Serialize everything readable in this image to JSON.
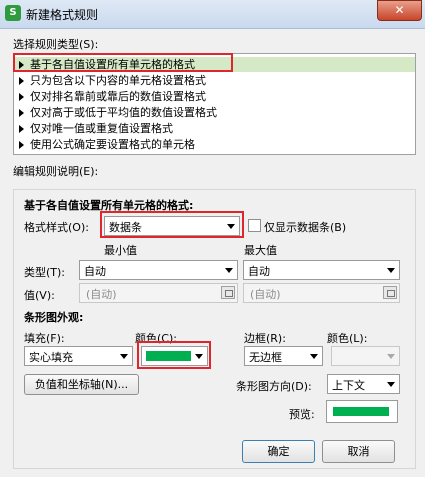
{
  "window": {
    "title": "新建格式规则",
    "app_icon_glyph": "S",
    "close_glyph": "✕"
  },
  "rule_type": {
    "label": "选择规则类型(S):",
    "items": [
      "基于各自值设置所有单元格的格式",
      "只为包含以下内容的单元格设置格式",
      "仅对排名靠前或靠后的数值设置格式",
      "仅对高于或低于平均值的数值设置格式",
      "仅对唯一值或重复值设置格式",
      "使用公式确定要设置格式的单元格"
    ],
    "selected_index": 0
  },
  "edit": {
    "label": "编辑规则说明(E):",
    "heading": "基于各自值设置所有单元格的格式:",
    "format_style_label": "格式样式(O):",
    "format_style_value": "数据条",
    "only_show_bar_label": "仅显示数据条(B)",
    "min_label": "最小值",
    "max_label": "最大值",
    "type_label": "类型(T):",
    "min_type": "自动",
    "max_type": "自动",
    "value_label": "值(V):",
    "min_value": "(自动)",
    "max_value": "(自动)"
  },
  "bar_appearance": {
    "heading": "条形图外观:",
    "fill_label": "填充(F):",
    "fill_value": "实心填充",
    "color_label": "颜色(C):",
    "border_label": "边框(R):",
    "border_value": "无边框",
    "border_color_label": "颜色(L):",
    "neg_axis_button": "负值和坐标轴(N)...",
    "direction_label": "条形图方向(D):",
    "direction_value": "上下文",
    "preview_label": "预览:",
    "bar_color": "#00b050"
  },
  "buttons": {
    "ok": "确定",
    "cancel": "取消"
  }
}
